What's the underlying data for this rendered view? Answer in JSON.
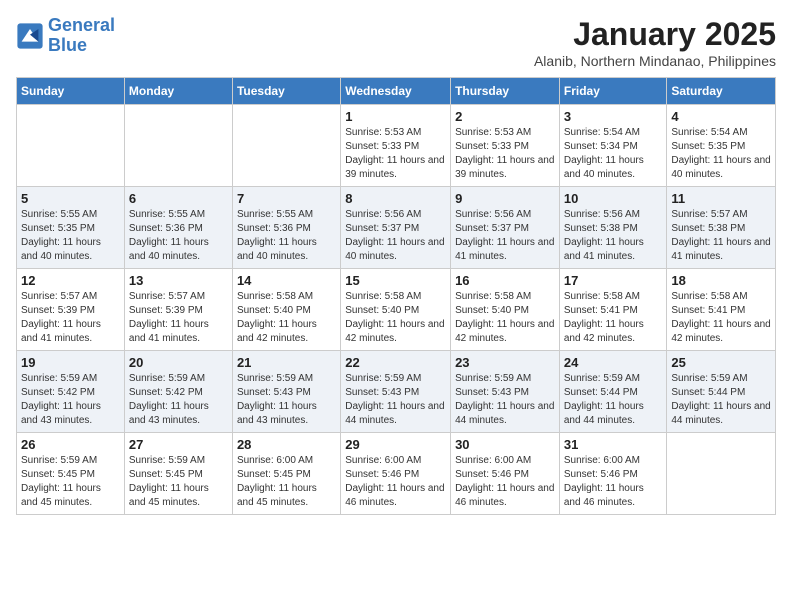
{
  "header": {
    "logo_line1": "General",
    "logo_line2": "Blue",
    "month": "January 2025",
    "location": "Alanib, Northern Mindanao, Philippines"
  },
  "weekdays": [
    "Sunday",
    "Monday",
    "Tuesday",
    "Wednesday",
    "Thursday",
    "Friday",
    "Saturday"
  ],
  "weeks": [
    [
      {
        "day": "",
        "info": ""
      },
      {
        "day": "",
        "info": ""
      },
      {
        "day": "",
        "info": ""
      },
      {
        "day": "1",
        "info": "Sunrise: 5:53 AM\nSunset: 5:33 PM\nDaylight: 11 hours and 39 minutes."
      },
      {
        "day": "2",
        "info": "Sunrise: 5:53 AM\nSunset: 5:33 PM\nDaylight: 11 hours and 39 minutes."
      },
      {
        "day": "3",
        "info": "Sunrise: 5:54 AM\nSunset: 5:34 PM\nDaylight: 11 hours and 40 minutes."
      },
      {
        "day": "4",
        "info": "Sunrise: 5:54 AM\nSunset: 5:35 PM\nDaylight: 11 hours and 40 minutes."
      }
    ],
    [
      {
        "day": "5",
        "info": "Sunrise: 5:55 AM\nSunset: 5:35 PM\nDaylight: 11 hours and 40 minutes."
      },
      {
        "day": "6",
        "info": "Sunrise: 5:55 AM\nSunset: 5:36 PM\nDaylight: 11 hours and 40 minutes."
      },
      {
        "day": "7",
        "info": "Sunrise: 5:55 AM\nSunset: 5:36 PM\nDaylight: 11 hours and 40 minutes."
      },
      {
        "day": "8",
        "info": "Sunrise: 5:56 AM\nSunset: 5:37 PM\nDaylight: 11 hours and 40 minutes."
      },
      {
        "day": "9",
        "info": "Sunrise: 5:56 AM\nSunset: 5:37 PM\nDaylight: 11 hours and 41 minutes."
      },
      {
        "day": "10",
        "info": "Sunrise: 5:56 AM\nSunset: 5:38 PM\nDaylight: 11 hours and 41 minutes."
      },
      {
        "day": "11",
        "info": "Sunrise: 5:57 AM\nSunset: 5:38 PM\nDaylight: 11 hours and 41 minutes."
      }
    ],
    [
      {
        "day": "12",
        "info": "Sunrise: 5:57 AM\nSunset: 5:39 PM\nDaylight: 11 hours and 41 minutes."
      },
      {
        "day": "13",
        "info": "Sunrise: 5:57 AM\nSunset: 5:39 PM\nDaylight: 11 hours and 41 minutes."
      },
      {
        "day": "14",
        "info": "Sunrise: 5:58 AM\nSunset: 5:40 PM\nDaylight: 11 hours and 42 minutes."
      },
      {
        "day": "15",
        "info": "Sunrise: 5:58 AM\nSunset: 5:40 PM\nDaylight: 11 hours and 42 minutes."
      },
      {
        "day": "16",
        "info": "Sunrise: 5:58 AM\nSunset: 5:40 PM\nDaylight: 11 hours and 42 minutes."
      },
      {
        "day": "17",
        "info": "Sunrise: 5:58 AM\nSunset: 5:41 PM\nDaylight: 11 hours and 42 minutes."
      },
      {
        "day": "18",
        "info": "Sunrise: 5:58 AM\nSunset: 5:41 PM\nDaylight: 11 hours and 42 minutes."
      }
    ],
    [
      {
        "day": "19",
        "info": "Sunrise: 5:59 AM\nSunset: 5:42 PM\nDaylight: 11 hours and 43 minutes."
      },
      {
        "day": "20",
        "info": "Sunrise: 5:59 AM\nSunset: 5:42 PM\nDaylight: 11 hours and 43 minutes."
      },
      {
        "day": "21",
        "info": "Sunrise: 5:59 AM\nSunset: 5:43 PM\nDaylight: 11 hours and 43 minutes."
      },
      {
        "day": "22",
        "info": "Sunrise: 5:59 AM\nSunset: 5:43 PM\nDaylight: 11 hours and 44 minutes."
      },
      {
        "day": "23",
        "info": "Sunrise: 5:59 AM\nSunset: 5:43 PM\nDaylight: 11 hours and 44 minutes."
      },
      {
        "day": "24",
        "info": "Sunrise: 5:59 AM\nSunset: 5:44 PM\nDaylight: 11 hours and 44 minutes."
      },
      {
        "day": "25",
        "info": "Sunrise: 5:59 AM\nSunset: 5:44 PM\nDaylight: 11 hours and 44 minutes."
      }
    ],
    [
      {
        "day": "26",
        "info": "Sunrise: 5:59 AM\nSunset: 5:45 PM\nDaylight: 11 hours and 45 minutes."
      },
      {
        "day": "27",
        "info": "Sunrise: 5:59 AM\nSunset: 5:45 PM\nDaylight: 11 hours and 45 minutes."
      },
      {
        "day": "28",
        "info": "Sunrise: 6:00 AM\nSunset: 5:45 PM\nDaylight: 11 hours and 45 minutes."
      },
      {
        "day": "29",
        "info": "Sunrise: 6:00 AM\nSunset: 5:46 PM\nDaylight: 11 hours and 46 minutes."
      },
      {
        "day": "30",
        "info": "Sunrise: 6:00 AM\nSunset: 5:46 PM\nDaylight: 11 hours and 46 minutes."
      },
      {
        "day": "31",
        "info": "Sunrise: 6:00 AM\nSunset: 5:46 PM\nDaylight: 11 hours and 46 minutes."
      },
      {
        "day": "",
        "info": ""
      }
    ]
  ]
}
